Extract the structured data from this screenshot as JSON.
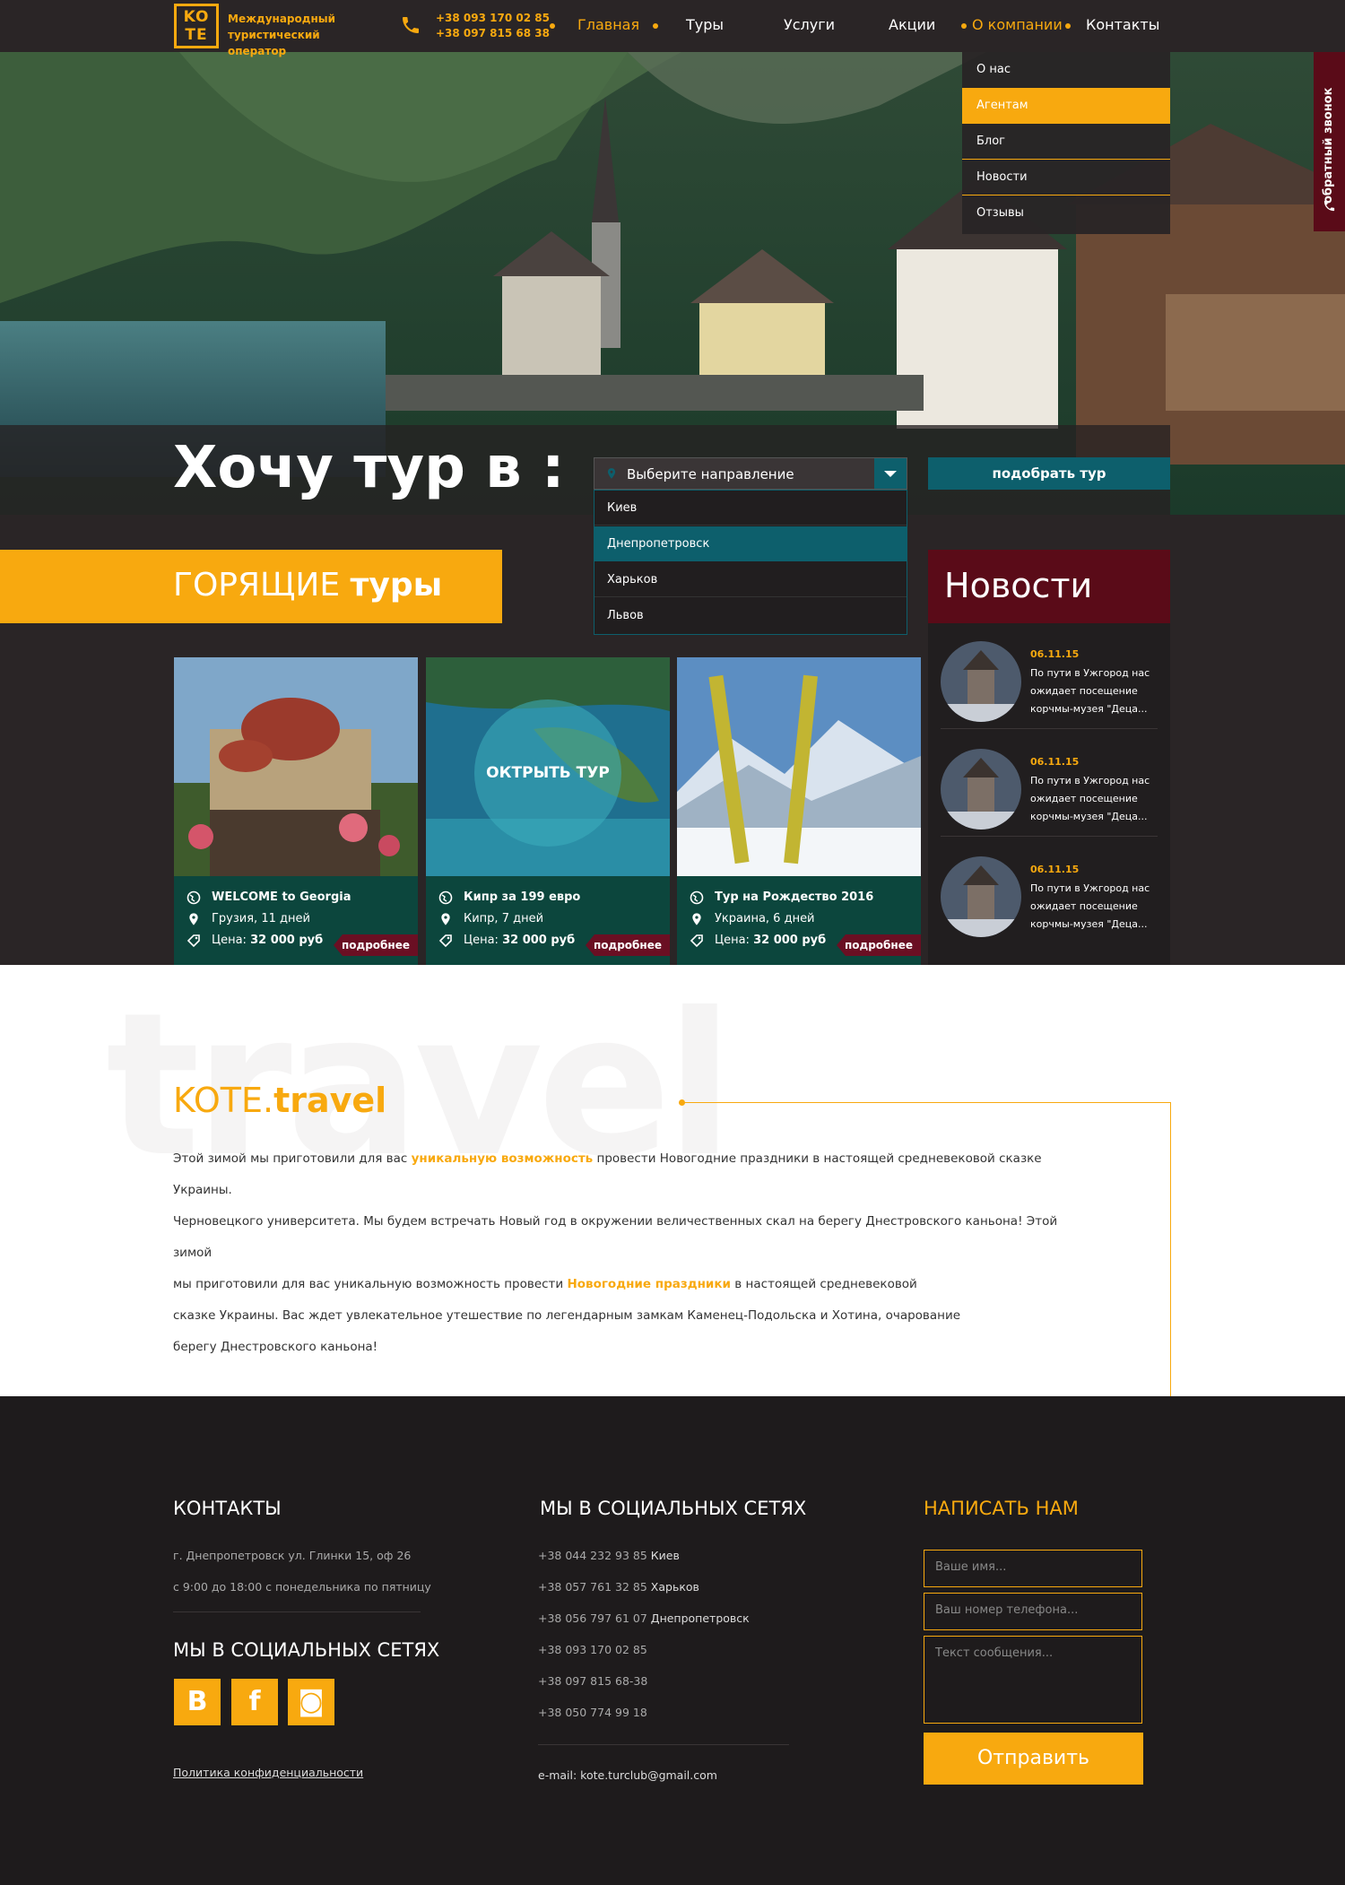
{
  "header": {
    "logo": "KO TE",
    "logo_line1": "Международный",
    "logo_line2": "туристический оператор",
    "phone1": "+38 093 170 02 85",
    "phone2": "+38 097 815 68 38",
    "nav": [
      "Главная",
      "Туры",
      "Услуги",
      "Акции",
      "О компании",
      "Контакты"
    ],
    "active_nav": "Главная",
    "submenu": [
      "О нас",
      "Агентам",
      "Блог",
      "Новости",
      "Отзывы"
    ],
    "submenu_active": "Агентам",
    "callback": "обратный звонок"
  },
  "search": {
    "want_text": "Хочу тур в :",
    "select_placeholder": "Выберите направление",
    "options": [
      "Киев",
      "Днепропетровск",
      "Харьков",
      "Львов"
    ],
    "highlighted_option": "Днепропетровск",
    "button": "подобрать тур"
  },
  "hot": {
    "title_light": "ГОРЯЩИЕ",
    "title_bold": "туры"
  },
  "tours": [
    {
      "name": "WELCOME to Georgia",
      "place": "Грузия, 11 дней",
      "price_label": "Цена:",
      "price": "32 000 руб",
      "more": "подробнее"
    },
    {
      "name": "Кипр за 199 евро",
      "place": "Кипр, 7 дней",
      "price_label": "Цена:",
      "price": "32 000 руб",
      "more": "подробнее",
      "overlay": "ОКТРЫТЬ ТУР"
    },
    {
      "name": "Тур на Рождество 2016",
      "place": "Украина, 6 дней",
      "price_label": "Цена:",
      "price": "32 000 руб",
      "more": "подробнее"
    }
  ],
  "news": {
    "title": "Новости",
    "items": [
      {
        "date": "06.11.15",
        "text": "По пути в Ужгород нас ожидает посещение корчмы-музея \"Деца..."
      },
      {
        "date": "06.11.15",
        "text": "По пути в Ужгород нас ожидает посещение корчмы-музея \"Деца..."
      },
      {
        "date": "06.11.15",
        "text": "По пути в Ужгород нас ожидает посещение корчмы-музея \"Деца..."
      }
    ]
  },
  "about": {
    "bg_word": "travel",
    "title_light": "KOTE.",
    "title_bold": "travel",
    "p1_a": "Этой зимой мы приготовили для вас ",
    "p1_hl": "уникальную возможность",
    "p1_b": " провести Новогодние праздники в настоящей средневековой сказке Украины.",
    "p2": "Черновецкого университета. Мы будем встречать Новый год в окружении величественных скал на берегу Днестровского каньона! Этой зимой",
    "p3_a": "мы приготовили для вас уникальную возможность провести ",
    "p3_hl": "Новогодние праздники",
    "p3_b": " в настоящей средневековой",
    "p4": "сказке Украины. Вас ждет увлекательное утешествие по легендарным замкам Каменец-Подольска и Хотина, очарование",
    "p5": "берегу Днестровского каньона!"
  },
  "footer": {
    "contacts_title": "КОНТАКТЫ",
    "address": "г. Днепропетровск ул. Глинки 15, оф 26",
    "hours": "с 9:00 до 18:00 с понедельника по пятницу",
    "social_title": "МЫ В СОЦИАЛЬНЫХ СЕТЯХ",
    "social": [
      "В",
      "f",
      "◙"
    ],
    "policy": "Политика конфиденциальности",
    "phones_title": "МЫ В СОЦИАЛЬНЫХ СЕТЯХ",
    "phones": [
      {
        "num": "+38 044 232 93 85",
        "city": "Киев"
      },
      {
        "num": "+38 057 761 32 85",
        "city": "Харьков"
      },
      {
        "num": "+38 056 797 61 07",
        "city": "Днепропетровск"
      },
      {
        "num": "+38 093 170 02 85",
        "city": ""
      },
      {
        "num": "+38 097 815 68-38",
        "city": ""
      },
      {
        "num": "+38 050 774 99 18",
        "city": ""
      }
    ],
    "email": "e-mail: kote.turclub@gmail.com",
    "write_title": "НАПИСАТЬ НАМ",
    "name_ph": "Ваше имя...",
    "phone_ph": "Ваш номер телефона...",
    "msg_ph": "Текст сообщения...",
    "send": "Отправить"
  },
  "colors": {
    "accent": "#f8a90f",
    "teal": "#0d5f6c",
    "maroon": "#5a0b18",
    "dark": "#2a2526",
    "card": "#0c463d"
  }
}
